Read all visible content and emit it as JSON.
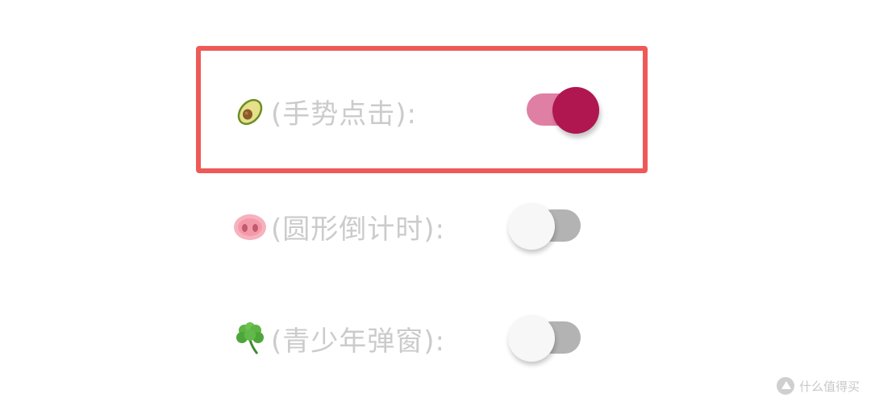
{
  "settings": [
    {
      "icon": "avocado-icon",
      "label": "(手势点击):",
      "enabled": true
    },
    {
      "icon": "pig-nose-icon",
      "label": "(圆形倒计时):",
      "enabled": false
    },
    {
      "icon": "shamrock-icon",
      "label": "(青少年弹窗):",
      "enabled": false
    }
  ],
  "watermark": {
    "text": "什么值得买"
  },
  "colors": {
    "highlight_border": "#ee5a57",
    "toggle_on_knob": "#b0164f",
    "toggle_on_track": "#e07fa4",
    "toggle_off_track": "#b3b3b3",
    "label_text": "#cbcbcb"
  }
}
